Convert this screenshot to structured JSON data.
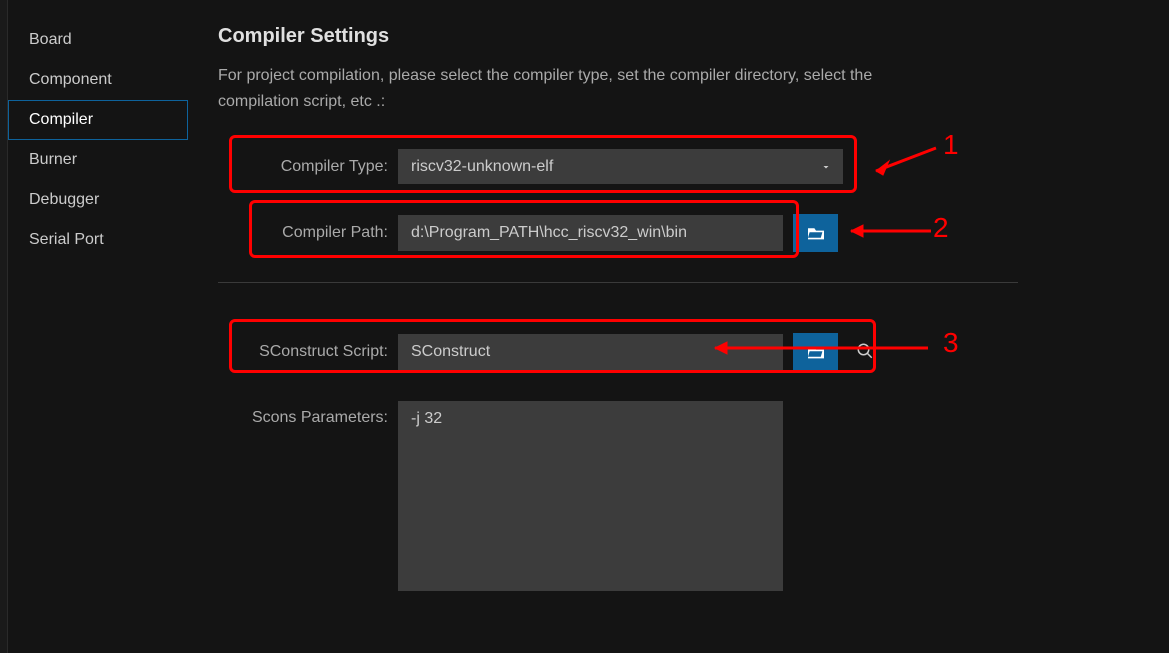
{
  "sidebar": {
    "items": [
      {
        "label": "Board"
      },
      {
        "label": "Component"
      },
      {
        "label": "Compiler"
      },
      {
        "label": "Burner"
      },
      {
        "label": "Debugger"
      },
      {
        "label": "Serial Port"
      }
    ],
    "activeIndex": 2
  },
  "main": {
    "title": "Compiler Settings",
    "subtitle": "For project compilation, please select the compiler type, set the compiler directory, select the compilation script, etc .:",
    "fields": {
      "compilerType": {
        "label": "Compiler Type:",
        "value": "riscv32-unknown-elf"
      },
      "compilerPath": {
        "label": "Compiler Path:",
        "value": "d:\\Program_PATH\\hcc_riscv32_win\\bin"
      },
      "sconstructScript": {
        "label": "SConstruct Script:",
        "value": "SConstruct"
      },
      "sconsParams": {
        "label": "Scons Parameters:",
        "value": "-j 32"
      }
    }
  },
  "annotations": {
    "n1": "1",
    "n2": "2",
    "n3": "3"
  }
}
